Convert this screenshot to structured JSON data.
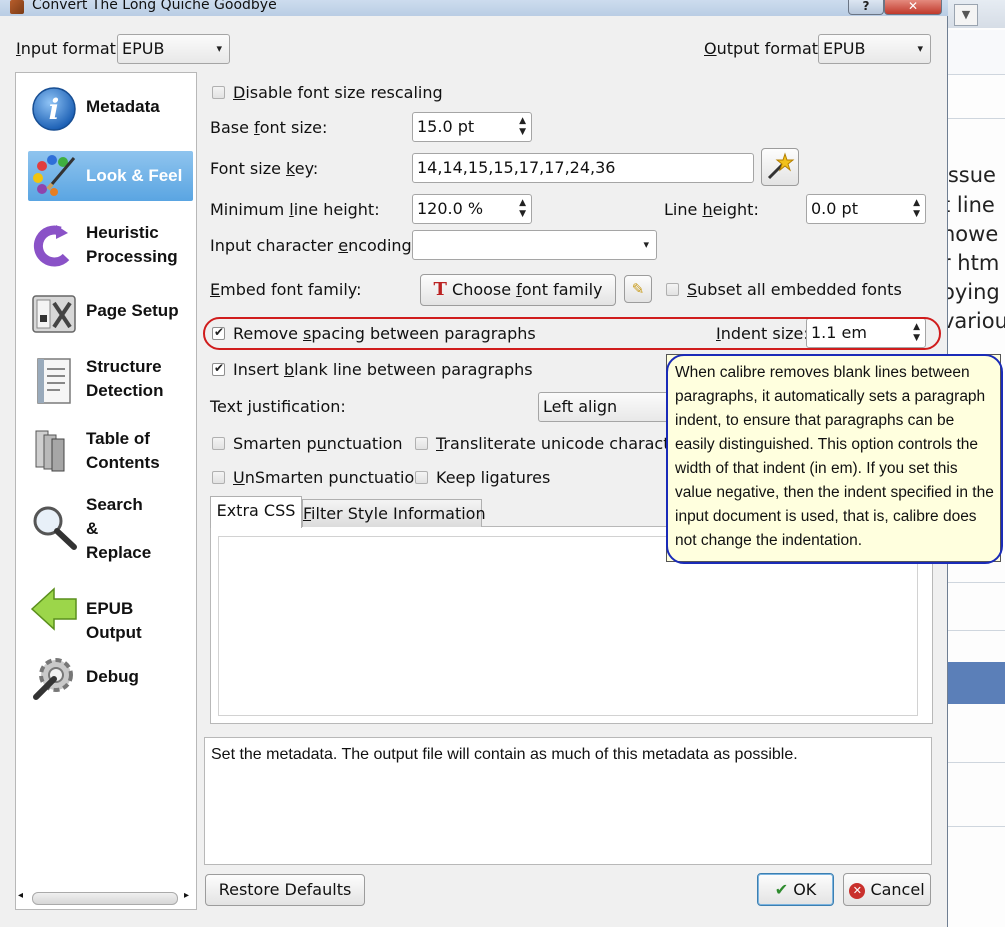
{
  "window": {
    "title": "Convert The Long Quiche Goodbye",
    "help_label": "?",
    "close_label": "✕"
  },
  "formats": {
    "input_label": "Input format:",
    "input_value": "EPUB",
    "output_label": "Output format:",
    "output_value": "EPUB"
  },
  "sidebar": {
    "items": [
      {
        "label": "Metadata",
        "icon": "info-icon",
        "selected": false
      },
      {
        "label": "Look & Feel",
        "icon": "palette-icon",
        "selected": true
      },
      {
        "label": "Heuristic\nProcessing",
        "icon": "heuristic-icon",
        "selected": false
      },
      {
        "label": "Page Setup",
        "icon": "page-setup-icon",
        "selected": false
      },
      {
        "label": "Structure\nDetection",
        "icon": "document-icon",
        "selected": false
      },
      {
        "label": "Table of\nContents",
        "icon": "books-icon",
        "selected": false
      },
      {
        "label": "Search\n&\nReplace",
        "icon": "magnifier-icon",
        "selected": false
      },
      {
        "label": "EPUB Output",
        "icon": "arrow-left-icon",
        "selected": false
      },
      {
        "label": "Debug",
        "icon": "gear-wrench-icon",
        "selected": false
      }
    ]
  },
  "look": {
    "disable_rescale": "Disable font size rescaling",
    "base_font_label": "Base font size:",
    "base_font_value": "15.0 pt",
    "font_key_label": "Font size key:",
    "font_key_value": "14,14,15,15,17,17,24,36",
    "min_line_label": "Minimum line height:",
    "min_line_value": "120.0 %",
    "line_height_label": "Line height:",
    "line_height_value": "0.0 pt",
    "encoding_label": "Input character encoding:",
    "encoding_value": "",
    "embed_label": "Embed font family:",
    "choose_font": "Choose font family",
    "subset_fonts": "Subset all embedded fonts",
    "remove_spacing": "Remove spacing between paragraphs",
    "indent_label": "Indent size:",
    "indent_value": "1.1 em",
    "insert_blank": "Insert blank line between paragraphs",
    "justification_label": "Text justification:",
    "justification_value": "Left align",
    "smarten": "Smarten punctuation",
    "transliterate": "Transliterate unicode characters",
    "unsmarten": "UnSmarten punctuation",
    "keep_ligatures": "Keep ligatures",
    "tab_extra_css": "Extra CSS",
    "tab_filter_style": "Filter Style Information"
  },
  "tooltip": "When calibre removes blank lines between paragraphs, it automatically sets a paragraph indent, to ensure that paragraphs can be easily distinguished. This option controls the width of that indent (in em). If you set this value negative, then the indent specified in the input document is used, that is, calibre does not change the indentation.",
  "description": "Set the metadata. The output file will contain as much of this metadata as possible.",
  "footer": {
    "restore": "Restore Defaults",
    "ok": "OK",
    "cancel": "Cancel"
  },
  "background_app": {
    "lines": [
      "issue",
      "t line",
      "howe",
      "r htm",
      "oying",
      "variou"
    ]
  },
  "colors": {
    "highlight_red": "#d01c1c",
    "highlight_blue": "#1a2bb8",
    "selected_item": "#5aa5e2",
    "tooltip_bg": "#ffffde"
  }
}
